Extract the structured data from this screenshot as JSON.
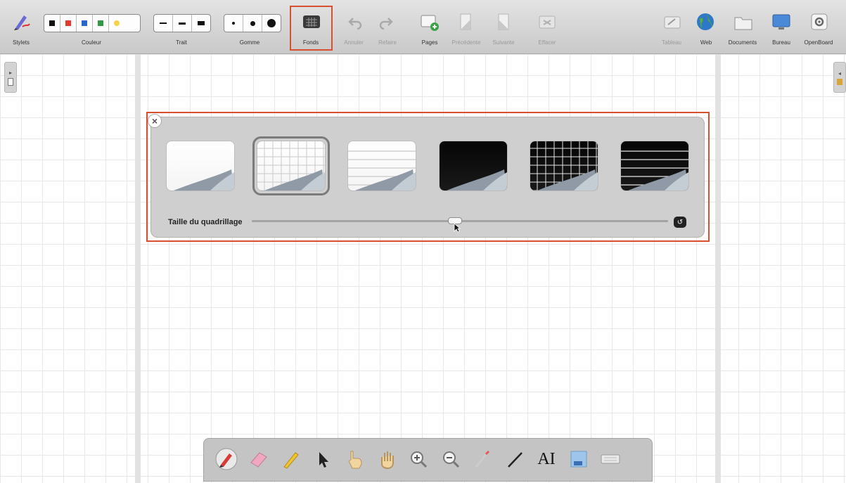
{
  "toolbar": {
    "stylets": "Stylets",
    "couleur": "Couleur",
    "trait": "Trait",
    "gomme": "Gomme",
    "fonds": "Fonds",
    "annuler": "Annuler",
    "refaire": "Refaire",
    "pages": "Pages",
    "precedente": "Précédente",
    "suivante": "Suivante",
    "effacer": "Effacer",
    "tableau": "Tableau",
    "web": "Web",
    "documents": "Documents",
    "bureau": "Bureau",
    "openboard": "OpenBoard",
    "colors": [
      "#111111",
      "#e53b2c",
      "#2b67c9",
      "#2f9a43",
      "#f3d34a"
    ]
  },
  "palette": {
    "grid_size_label": "Taille du quadrillage",
    "selected_index": 1,
    "backgrounds": [
      {
        "name": "plain-white",
        "dark": false,
        "pattern": "plain"
      },
      {
        "name": "grid-white",
        "dark": false,
        "pattern": "grid"
      },
      {
        "name": "lines-white",
        "dark": false,
        "pattern": "lines"
      },
      {
        "name": "plain-black",
        "dark": true,
        "pattern": "plain"
      },
      {
        "name": "grid-black",
        "dark": true,
        "pattern": "grid"
      },
      {
        "name": "lines-black",
        "dark": true,
        "pattern": "lines"
      }
    ],
    "slider_value": 0.47
  },
  "dock": {
    "tools": [
      "pen-icon",
      "eraser-icon",
      "highlighter-icon",
      "pointer-icon",
      "interact-hand-icon",
      "pan-hand-icon",
      "zoom-in-icon",
      "zoom-out-icon",
      "laser-pointer-icon",
      "line-icon",
      "text-icon",
      "capture-icon",
      "keyboard-icon"
    ],
    "text_tool_label": "AI"
  },
  "accent": "#d9502e"
}
